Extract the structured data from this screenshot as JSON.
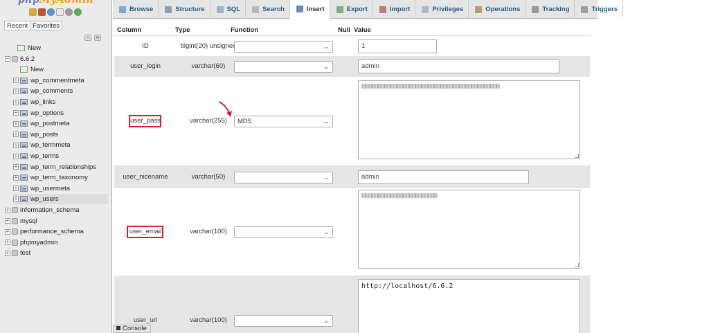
{
  "sidebar": {
    "logo_part1": "php",
    "logo_part2": "MyAdmin",
    "tabs": [
      "Recent",
      "Favorites"
    ],
    "tree": [
      {
        "label": "New",
        "level": 0,
        "kind": "new"
      },
      {
        "label": "6.6.2",
        "level": 0,
        "kind": "db",
        "expanded": true
      },
      {
        "label": "New",
        "level": 1,
        "kind": "new"
      },
      {
        "label": "wp_commentmeta",
        "level": 1,
        "kind": "table"
      },
      {
        "label": "wp_comments",
        "level": 1,
        "kind": "table"
      },
      {
        "label": "wp_links",
        "level": 1,
        "kind": "table"
      },
      {
        "label": "wp_options",
        "level": 1,
        "kind": "table"
      },
      {
        "label": "wp_postmeta",
        "level": 1,
        "kind": "table"
      },
      {
        "label": "wp_posts",
        "level": 1,
        "kind": "table"
      },
      {
        "label": "wp_termmeta",
        "level": 1,
        "kind": "table"
      },
      {
        "label": "wp_terms",
        "level": 1,
        "kind": "table"
      },
      {
        "label": "wp_term_relationships",
        "level": 1,
        "kind": "table"
      },
      {
        "label": "wp_term_taxonomy",
        "level": 1,
        "kind": "table"
      },
      {
        "label": "wp_usermeta",
        "level": 1,
        "kind": "table"
      },
      {
        "label": "wp_users",
        "level": 1,
        "kind": "table",
        "selected": true
      },
      {
        "label": "information_schema",
        "level": 0,
        "kind": "db"
      },
      {
        "label": "mysql",
        "level": 0,
        "kind": "db"
      },
      {
        "label": "performance_schema",
        "level": 0,
        "kind": "db"
      },
      {
        "label": "phpmyadmin",
        "level": 0,
        "kind": "db"
      },
      {
        "label": "test",
        "level": 0,
        "kind": "db"
      }
    ]
  },
  "toolbar": {
    "tabs": [
      {
        "label": "Browse",
        "icon": "browse-icon",
        "color": "#7fa9c9"
      },
      {
        "label": "Structure",
        "icon": "structure-icon",
        "color": "#8aa2b8"
      },
      {
        "label": "SQL",
        "icon": "sql-icon",
        "color": "#9bb4cc"
      },
      {
        "label": "Search",
        "icon": "search-icon",
        "color": "#b8b8b8"
      },
      {
        "label": "Insert",
        "icon": "insert-icon",
        "color": "#6a8fb0",
        "active": true
      },
      {
        "label": "Export",
        "icon": "export-icon",
        "color": "#7ab27a"
      },
      {
        "label": "Import",
        "icon": "import-icon",
        "color": "#c07a7a"
      },
      {
        "label": "Privileges",
        "icon": "privileges-icon",
        "color": "#aab8c8"
      },
      {
        "label": "Operations",
        "icon": "operations-icon",
        "color": "#b0a070"
      },
      {
        "label": "Tracking",
        "icon": "tracking-icon",
        "color": "#999999"
      },
      {
        "label": "Triggers",
        "icon": "triggers-icon",
        "color": "#a0a0a0"
      }
    ]
  },
  "table_header": {
    "column": "Column",
    "type": "Type",
    "function": "Function",
    "null": "Null",
    "value": "Value"
  },
  "fields": [
    {
      "name": "ID",
      "type": "bigint(20) unsigned",
      "function": "",
      "value": "1"
    },
    {
      "name": "user_login",
      "type": "varchar(60)",
      "function": "",
      "value": "admin"
    },
    {
      "name": "user_pass",
      "type": "varchar(255)",
      "function": "MD5",
      "value": ""
    },
    {
      "name": "user_nicename",
      "type": "varchar(50)",
      "function": "",
      "value": "admin"
    },
    {
      "name": "user_email",
      "type": "varchar(100)",
      "function": "",
      "value": ""
    },
    {
      "name": "user_url",
      "type": "varchar(100)",
      "function": "",
      "value": "http://localhost/6.6.2"
    }
  ],
  "colors": {
    "highlight": "#d11f2b",
    "link": "#235a81",
    "row_alt": "#e5e5e5"
  },
  "console_label": "Console"
}
